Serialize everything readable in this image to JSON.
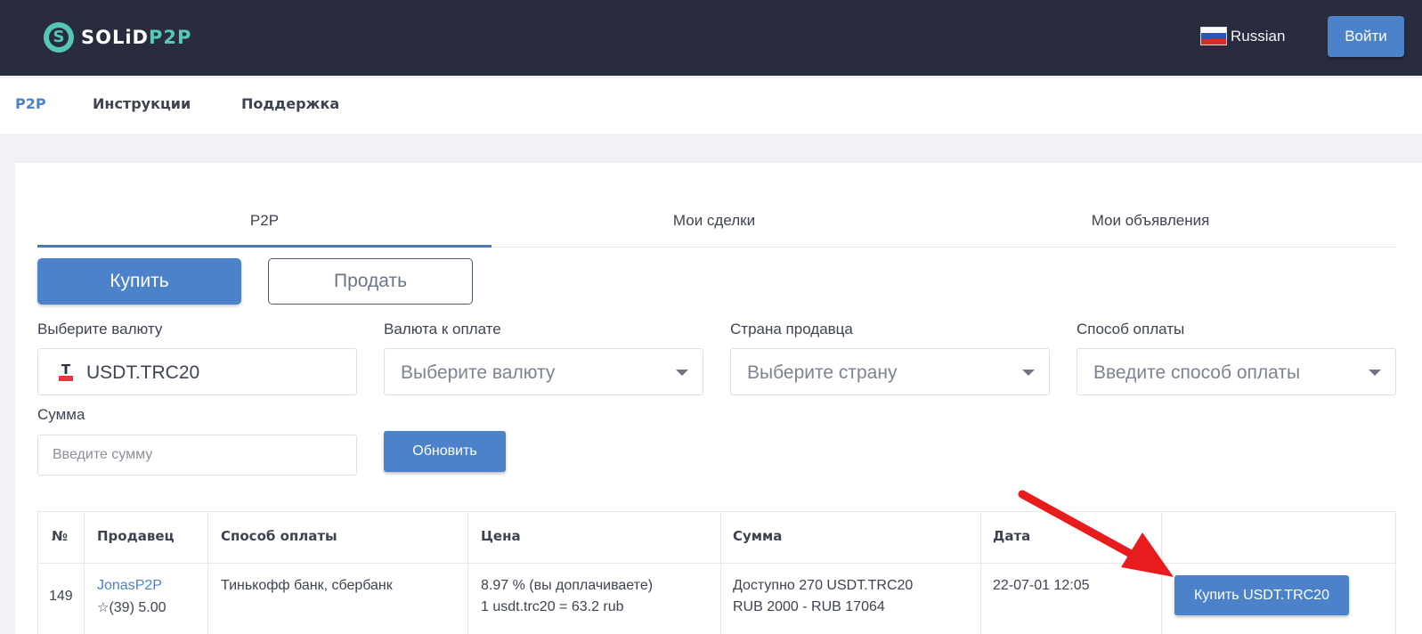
{
  "header": {
    "logo_part1": "SOLiD",
    "logo_part2": "P2P",
    "language": "Russian",
    "login_label": "Войти"
  },
  "nav": {
    "items": [
      {
        "label": "P2P",
        "active": true
      },
      {
        "label": "Инструкции",
        "active": false
      },
      {
        "label": "Поддержка",
        "active": false
      }
    ]
  },
  "tabs": [
    {
      "label": "P2P",
      "active": true
    },
    {
      "label": "Мои сделки",
      "active": false
    },
    {
      "label": "Мои объявления",
      "active": false
    }
  ],
  "actions": {
    "buy_label": "Купить",
    "sell_label": "Продать"
  },
  "filters": {
    "currency_label": "Выберите валюту",
    "currency_value": "USDT.TRC20",
    "pay_currency_label": "Валюта к оплате",
    "pay_currency_placeholder": "Выберите валюту",
    "country_label": "Страна продавца",
    "country_placeholder": "Выберите страну",
    "method_label": "Способ оплаты",
    "method_placeholder": "Введите способ оплаты",
    "sum_label": "Сумма",
    "sum_placeholder": "Введите сумму",
    "refresh_label": "Обновить"
  },
  "table": {
    "headers": [
      "№",
      "Продавец",
      "Способ оплаты",
      "Цена",
      "Сумма",
      "Дата"
    ],
    "rows": [
      {
        "num": "149",
        "seller": "JonasP2P",
        "rating": "(39) 5.00",
        "method": "Тинькофф банк, сбербанк",
        "price_line1": "8.97 % (вы доплачиваете)",
        "price_line2": "1 usdt.trc20 = 63.2 rub",
        "sum_line1": "Доступно 270 USDT.TRC20",
        "sum_line2": "RUB 2000 - RUB 17064",
        "date": "22-07-01 12:05",
        "action_label": "Купить USDT.TRC20"
      }
    ]
  },
  "colors": {
    "header_bg": "#282c3e",
    "accent": "#4b82c9",
    "logo_accent": "#56c7b2",
    "annotation_arrow": "#e81c1c"
  }
}
